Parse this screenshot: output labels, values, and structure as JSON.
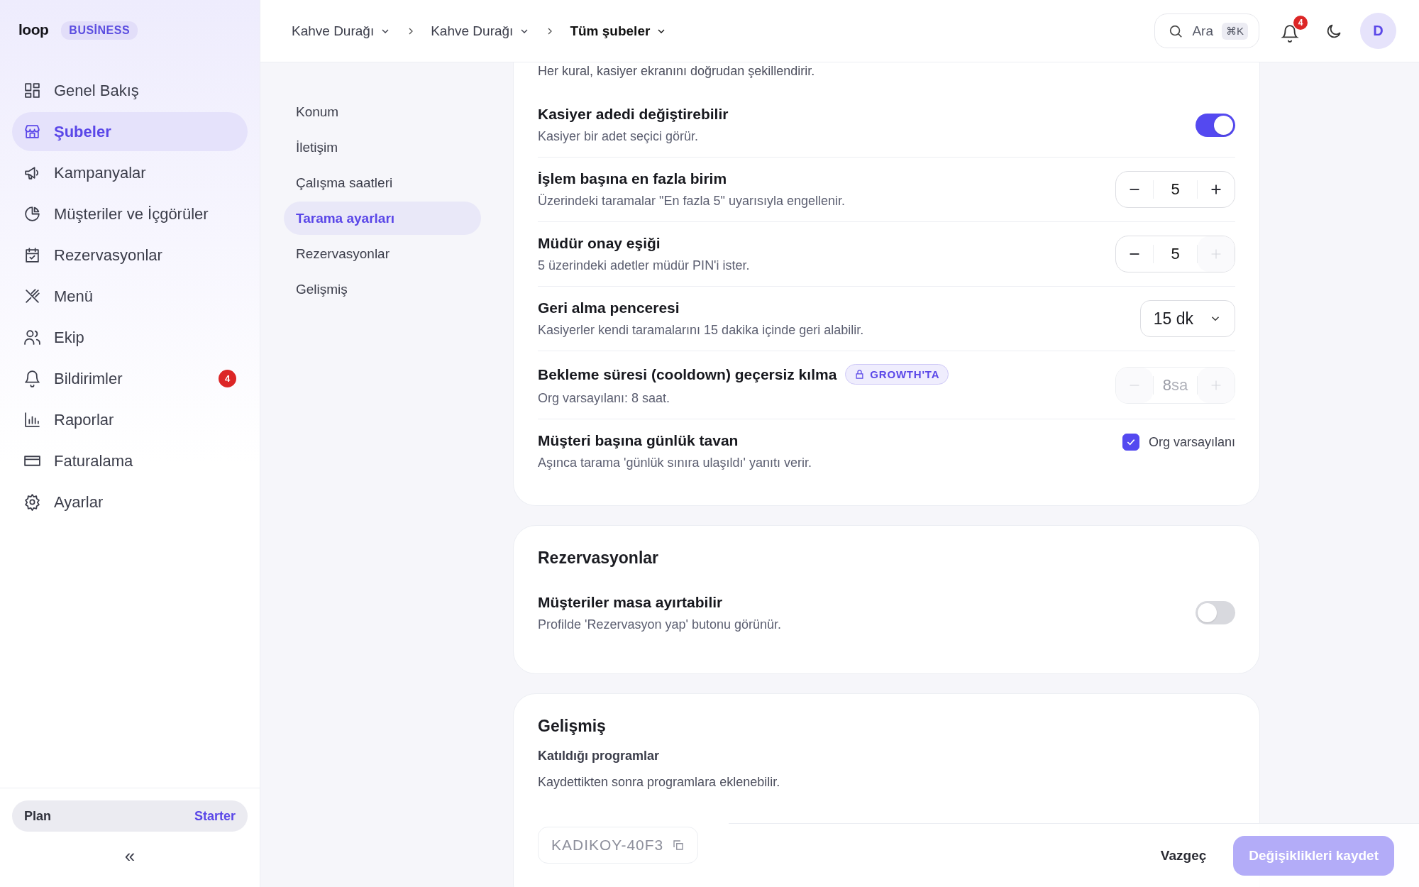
{
  "sidebar": {
    "logo": "loop",
    "plan_badge": "BUSİNESS",
    "items": [
      {
        "label": "Genel Bakış",
        "selected": false
      },
      {
        "label": "Şubeler",
        "selected": true
      },
      {
        "label": "Kampanyalar",
        "selected": false
      },
      {
        "label": "Müşteriler ve İçgörüler",
        "selected": false
      },
      {
        "label": "Rezervasyonlar",
        "selected": false
      },
      {
        "label": "Menü",
        "selected": false
      },
      {
        "label": "Ekip",
        "selected": false
      },
      {
        "label": "Bildirimler",
        "selected": false,
        "badge": "4"
      },
      {
        "label": "Raporlar",
        "selected": false
      },
      {
        "label": "Faturalama",
        "selected": false
      },
      {
        "label": "Ayarlar",
        "selected": false
      }
    ],
    "plan": {
      "label": "Plan",
      "value": "Starter"
    },
    "collapse": "«"
  },
  "header": {
    "breadcrumbs": [
      {
        "label": "Kahve Durağı",
        "current": false
      },
      {
        "label": "Kahve Durağı",
        "current": false
      },
      {
        "label": "Tüm şubeler",
        "current": true
      }
    ],
    "search": {
      "placeholder": "Ara",
      "shortcut": "⌘K"
    },
    "notifications": "4",
    "avatar": "D"
  },
  "section_nav": [
    {
      "label": "Konum",
      "selected": false
    },
    {
      "label": "İletişim",
      "selected": false
    },
    {
      "label": "Çalışma saatleri",
      "selected": false
    },
    {
      "label": "Tarama ayarları",
      "selected": true
    },
    {
      "label": "Rezervasyonlar",
      "selected": false
    },
    {
      "label": "Gelişmiş",
      "selected": false
    }
  ],
  "cards": [
    {
      "description": "Her kural, kasiyer ekranını doğrudan şekillendirir.",
      "rows": [
        {
          "kind": "toggle",
          "title": "Kasiyer adedi değiştirebilir",
          "description": "Kasiyer bir adet seçici görür.",
          "on": true
        },
        {
          "kind": "stepper",
          "title": "İşlem başına en fazla birim",
          "description": "Üzerindeki taramalar \"En fazla 5\" uyarısıyla engellenir.",
          "value": "5",
          "disabled": false,
          "minus_disabled": false,
          "plus_disabled": false
        },
        {
          "kind": "stepper",
          "title": "Müdür onay eşiği",
          "description": "5 üzerindeki adetler müdür PIN'i ister.",
          "value": "5",
          "disabled": false,
          "minus_disabled": false,
          "plus_disabled": true
        },
        {
          "kind": "select",
          "title": "Geri alma penceresi",
          "description": "Kasiyerler kendi taramalarını 15 dakika içinde geri alabilir.",
          "value": "15 dk"
        },
        {
          "kind": "stepper",
          "title": "Bekleme süresi (cooldown) geçersiz kılma",
          "tag": "GROWTH'TA",
          "description": "Org varsayılanı: 8 saat.",
          "value": "8",
          "unit": "sa",
          "disabled": true,
          "minus_disabled": true,
          "plus_disabled": true
        },
        {
          "kind": "checkbox",
          "title": "Müşteri başına günlük tavan",
          "description": "Aşınca tarama 'günlük sınıra ulaşıldı' yanıtı verir.",
          "checked": true,
          "label": "Org varsayılanı"
        }
      ]
    },
    {
      "title": "Rezervasyonlar",
      "rows": [
        {
          "kind": "toggle",
          "title": "Müşteriler masa ayırtabilir",
          "description": "Profilde 'Rezervasyon yap' butonu görünür.",
          "on": false
        }
      ]
    },
    {
      "title": "Gelişmiş",
      "subheading": "Katıldığı programlar",
      "note": "Kaydettikten sonra programlara eklenebilir.",
      "code": "KADIKOY-40F3"
    }
  ],
  "footer": {
    "cancel": "Vazgeç",
    "save": {
      "label": "Değişiklikleri kaydet",
      "disabled": true
    }
  }
}
